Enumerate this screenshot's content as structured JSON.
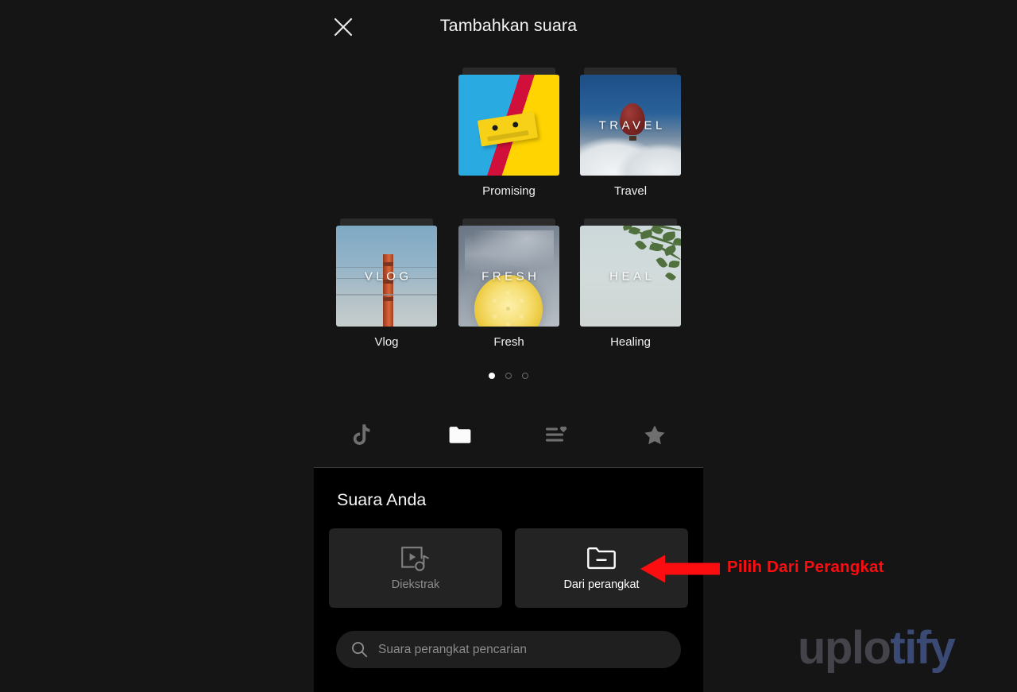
{
  "header": {
    "title": "Tambahkan suara",
    "close_icon": "close-icon"
  },
  "categories": {
    "rows": [
      [
        {
          "label": "Promising",
          "overlay": "",
          "art": "promising"
        },
        {
          "label": "Travel",
          "overlay": "TRAVEL",
          "art": "travel"
        }
      ],
      [
        {
          "label": "Vlog",
          "overlay": "VLOG",
          "art": "vlog"
        },
        {
          "label": "Fresh",
          "overlay": "FRESH",
          "art": "fresh"
        },
        {
          "label": "Healing",
          "overlay": "HEAL",
          "art": "heal"
        }
      ]
    ]
  },
  "pager": {
    "total": 3,
    "active_index": 0
  },
  "tabbar": {
    "items": [
      {
        "icon": "tiktok-note-icon",
        "active": false
      },
      {
        "icon": "folder-icon",
        "active": true
      },
      {
        "icon": "playlist-heart-icon",
        "active": false
      },
      {
        "icon": "star-icon",
        "active": false
      }
    ]
  },
  "sheet": {
    "title": "Suara Anda",
    "sources": [
      {
        "label": "Diekstrak",
        "icon": "video-music-extract-icon",
        "enabled": false
      },
      {
        "label": "Dari perangkat",
        "icon": "folder-minus-icon",
        "enabled": true
      }
    ],
    "search": {
      "placeholder": "Suara perangkat pencarian",
      "value": "",
      "icon": "search-icon"
    }
  },
  "annotation": {
    "text": "Pilih Dari Perangkat",
    "color": "#fb0d10",
    "arrow_direction": "left"
  },
  "watermark": {
    "part_a": "uplo",
    "part_b": "tify"
  },
  "colors": {
    "page_background": "#151515",
    "sheet_background": "#000000",
    "button_background": "#232323",
    "search_background": "#1f1f1f",
    "accent_annotation": "#fb0d10"
  }
}
